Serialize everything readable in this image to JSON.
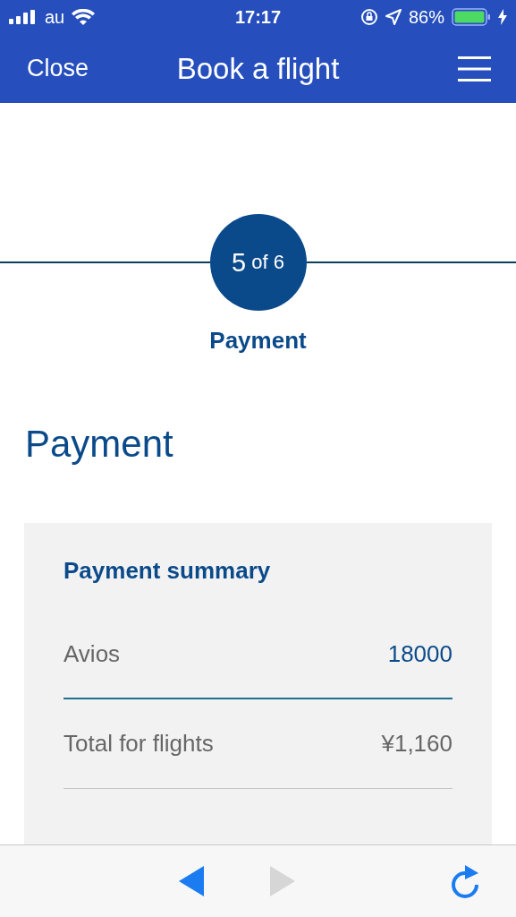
{
  "status_bar": {
    "carrier": "au",
    "time": "17:17",
    "battery": "86%"
  },
  "header": {
    "close": "Close",
    "title": "Book a flight"
  },
  "stepper": {
    "step": "5",
    "of": "of 6",
    "label": "Payment"
  },
  "heading": "Payment",
  "summary": {
    "title": "Payment summary",
    "rows": [
      {
        "label": "Avios",
        "value": "18000",
        "kind": "highlight"
      },
      {
        "label": "Total for flights",
        "value": "¥1,160",
        "kind": "plain"
      }
    ]
  },
  "toolbar": {
    "back": {
      "disabled": false
    },
    "forward": {
      "disabled": true
    }
  }
}
